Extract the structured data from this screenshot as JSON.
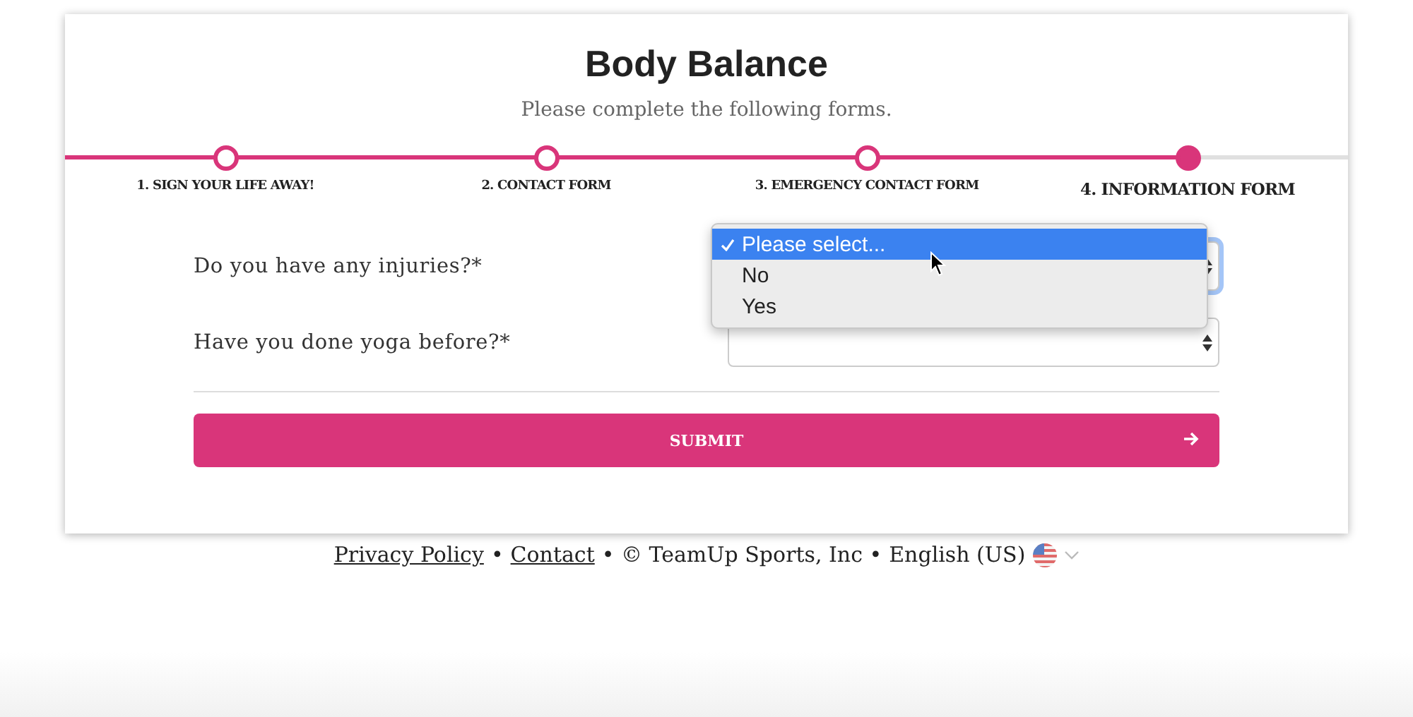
{
  "title": "Body Balance",
  "subtitle": "Please complete the following forms.",
  "steps": [
    {
      "label": "1. SIGN YOUR LIFE AWAY!",
      "selected": false
    },
    {
      "label": "2. CONTACT FORM",
      "selected": false
    },
    {
      "label": "3. EMERGENCY CONTACT FORM",
      "selected": false
    },
    {
      "label": "4. INFORMATION FORM",
      "selected": true
    }
  ],
  "fields": [
    {
      "label": "Do you have any injuries?*",
      "focused": true,
      "open_menu_options": [
        {
          "label": "Please select...",
          "selected": true
        },
        {
          "label": "No",
          "selected": false
        },
        {
          "label": "Yes",
          "selected": false
        }
      ]
    },
    {
      "label": "Have you done yoga before?*",
      "focused": false
    }
  ],
  "submit_label": "SUBMIT",
  "footer": [
    {
      "kind": "link",
      "text": "Privacy Policy"
    },
    {
      "kind": "text",
      "text": "•"
    },
    {
      "kind": "link",
      "text": "Contact"
    },
    {
      "kind": "text",
      "text": "• © TeamUp Sports, Inc •"
    },
    {
      "kind": "language",
      "text": "English (US)"
    }
  ]
}
